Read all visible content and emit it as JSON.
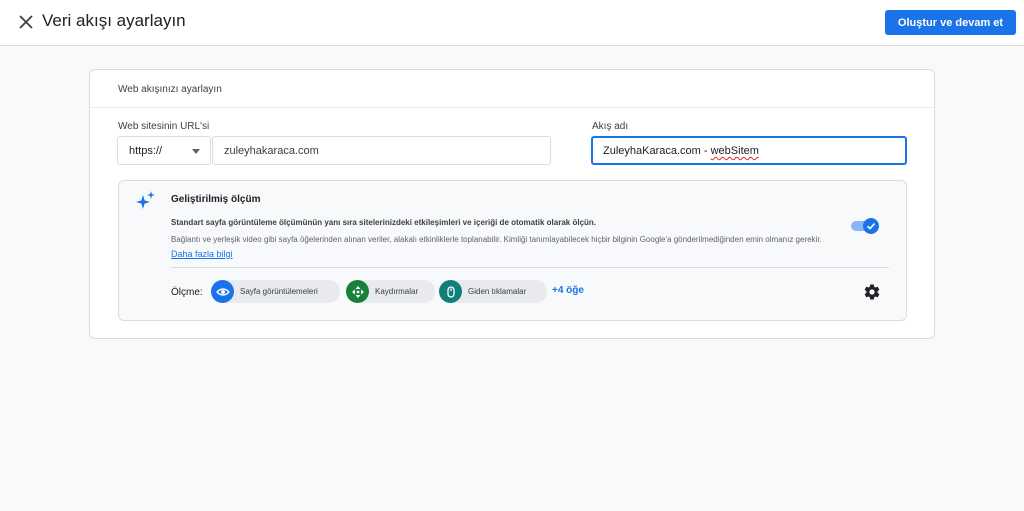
{
  "header": {
    "title": "Veri akışı ayarlayın",
    "primary_button": "Oluştur ve devam et"
  },
  "card": {
    "header": "Web akışınızı ayarlayın",
    "url_label": "Web sitesinin URL'si",
    "protocol": "https://",
    "url_value": "zuleyhakaraca.com",
    "name_label": "Akış adı",
    "name_value_part1": "ZuleyhaKaraca.com - ",
    "name_value_part2": "webSitem"
  },
  "enhanced": {
    "title": "Geliştirilmiş ölçüm",
    "description_bold": "Standart sayfa görüntüleme ölçümünün yanı sıra sitelerinizdeki etkileşimleri ve içeriği de otomatik olarak ölçün.",
    "description": "Bağlantı ve yerleşik video gibi sayfa öğelerinden alınan veriler, alakalı etkinliklerle toplanabilir. Kimliği tanımlayabilecek hiçbir bilginin Google'a gönderilmediğinden emin olmanız gerekir.",
    "learn_more": "Daha fazla bilgi",
    "toggle_on": true,
    "measure_label": "Ölçme:",
    "chips": [
      {
        "label": "Sayfa görüntülemeleri",
        "icon": "eye-icon",
        "color": "#1a73e8"
      },
      {
        "label": "Kaydırmalar",
        "icon": "scroll-icon",
        "color": "#188038"
      },
      {
        "label": "Giden tıklamalar",
        "icon": "mouse-icon",
        "color": "#12807a"
      }
    ],
    "more": "+4 öğe"
  },
  "colors": {
    "accent": "#1a73e8",
    "background": "#f8f9fa"
  }
}
